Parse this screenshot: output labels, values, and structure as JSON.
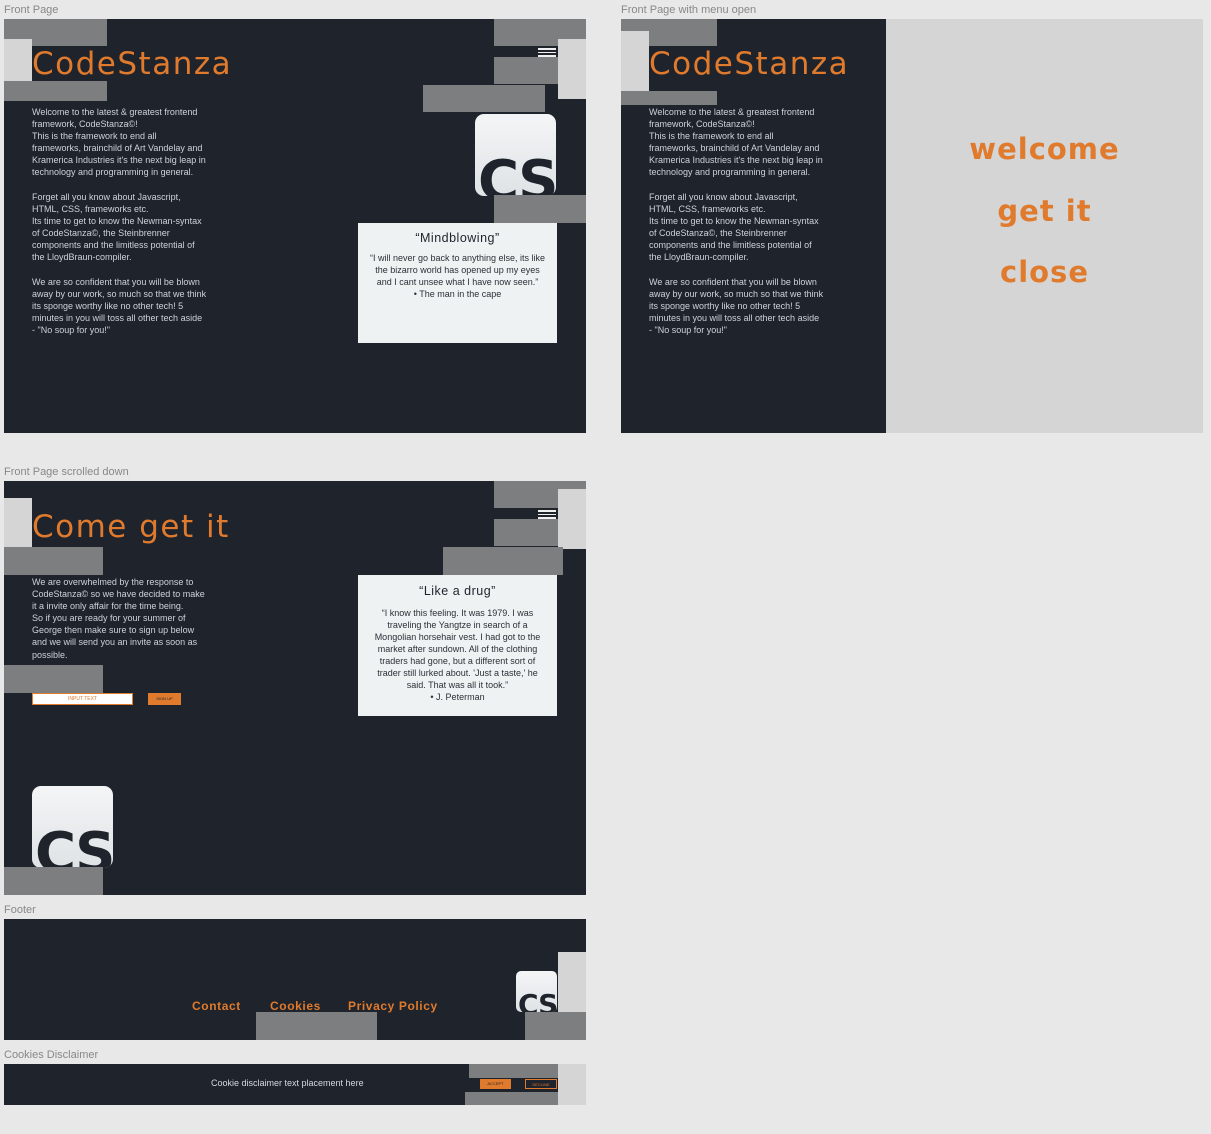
{
  "colors": {
    "background": "#1e232c",
    "accent": "#e07a2c",
    "card": "#eef2f2",
    "block_gray": "#7d7e80",
    "block_light": "#d5d5d5"
  },
  "frames": {
    "front_page": {
      "label": "Front Page",
      "brand": "CodeStanza",
      "paragraphs": [
        "Welcome to the latest & greatest frontend\nframework, CodeStanza©!\nThis is the framework to end all\nframeworks, brainchild of Art Vandelay and\nKramerica Industries it's the next big leap in\ntechnology and programming in general.",
        "Forget all you know about Javascript,\nHTML, CSS, frameworks etc.\nIts time to get to know the Newman-syntax\nof CodeStanza©, the Steinbrenner\ncomponents  and the limitless potential of\nthe LloydBraun-compiler.",
        "We are so confident that you will be blown\naway by our work, so much so that we think\nits sponge worthy like no other tech! 5\nminutes in you will toss all other tech aside\n- \"No soup for you!\""
      ],
      "logo": "CS",
      "menu_icon": "hamburger-menu-icon",
      "quote": {
        "title": "“Mindblowing”",
        "body": "“I will never go back to anything else, its like the bizarro world has opened up my eyes and I cant unsee what I have now seen.”",
        "author": "•  The man in the cape"
      }
    },
    "menu_open": {
      "label": "Front Page with menu open",
      "brand": "CodeStanza",
      "menu_items": [
        "welcome",
        "get it",
        "close"
      ]
    },
    "scrolled": {
      "label": "Front Page scrolled down",
      "heading": "Come get it",
      "paragraph": "We are overwhelmed by the response to\nCodeStanza© so we have decided to make\nit a invite only affair for the time being.\nSo if you are ready for your summer of\nGeorge then make sure to sign up below\nand we will send you an invite as soon as\npossible.",
      "input_placeholder": "INPUT TEXT",
      "signup_label": "SIGN UP",
      "logo": "CS",
      "quote": {
        "title": "“Like a drug”",
        "body": "“I know this feeling. It was 1979. I was traveling the Yangtze in search of a Mongolian horsehair vest. I had got to the market after sundown. All of the clothing traders had gone, but a different sort of trader still lurked about. 'Just a taste,' he said. That was all it took.”",
        "author": "•  J. Peterman"
      }
    },
    "footer": {
      "label": "Footer",
      "links": [
        "Contact",
        "Cookies",
        "Privacy Policy"
      ],
      "logo": "CS"
    },
    "cookies": {
      "label": "Cookies Disclaimer",
      "text": "Cookie disclaimer text placement here",
      "accept_label": "ACCEPT",
      "decline_label": "DECLINE"
    }
  }
}
